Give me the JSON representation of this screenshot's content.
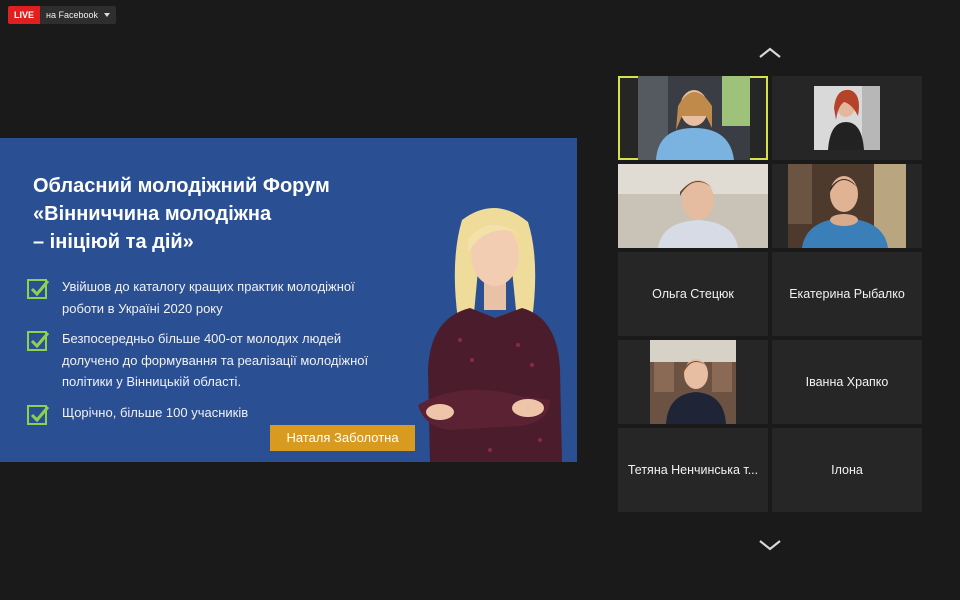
{
  "live": {
    "badge": "LIVE",
    "target": "на Facebook"
  },
  "slide": {
    "title": "Обласний молодіжний Форум\n«Вінниччина молодіжна\n– ініціюй та дій»",
    "bullets": [
      "Увійшов до каталогу кращих практик молодіжної роботи в Україні 2020 року",
      "Безпосередньо більше 400-от молодих людей долучено до формування та реалізації молодіжної політики у Вінницькій області.",
      "Щорічно, більше 100 учасників"
    ],
    "presenter_name": "Наталя Заболотна"
  },
  "participants": [
    {
      "name": "",
      "video": true
    },
    {
      "name": "",
      "video": true
    },
    {
      "name": "",
      "video": true
    },
    {
      "name": "",
      "video": true
    },
    {
      "name": "Ольга Стецюк",
      "video": false
    },
    {
      "name": "Екатерина Рыбалко",
      "video": false
    },
    {
      "name": "",
      "video": true
    },
    {
      "name": "Іванна Храпко",
      "video": false
    },
    {
      "name": "Тетяна Ненчинська т...",
      "video": false
    },
    {
      "name": "Ілона",
      "video": false
    }
  ],
  "colors": {
    "background": "#1a1a1a",
    "slide_blue": "#2a4f93",
    "check_green": "#8fd14f",
    "name_tag": "#d89a1f",
    "live_red": "#e02020",
    "active_speaker": "#d6e24c"
  }
}
